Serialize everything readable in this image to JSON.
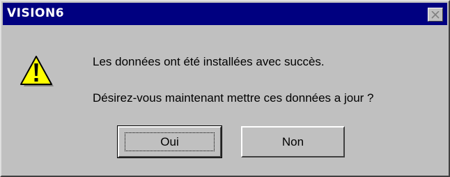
{
  "window": {
    "title": "VISION6",
    "titlebar_color": "#000080",
    "background_color": "#c0c0c0"
  },
  "dialog": {
    "icon": "warning-icon",
    "message_line1": "Les données ont été installées avec succès.",
    "message_line2": "Désirez-vous maintenant mettre ces données a jour ?"
  },
  "buttons": {
    "yes_label": "Oui",
    "no_label": "Non"
  }
}
